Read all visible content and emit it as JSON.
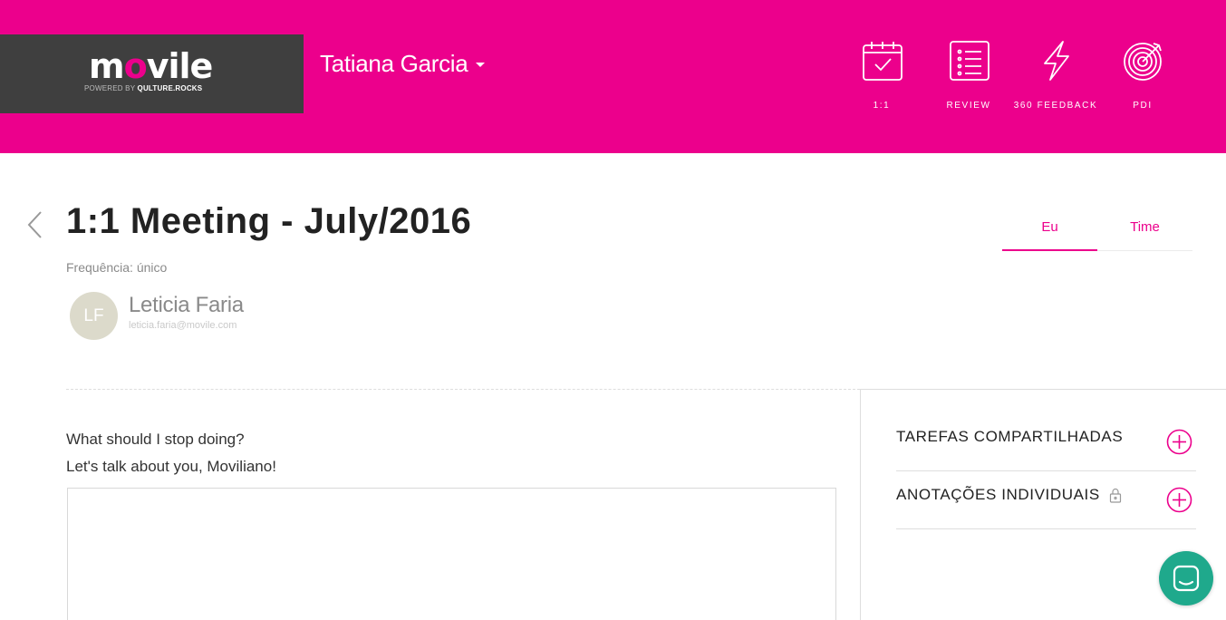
{
  "brand": {
    "logo_prefix": "m",
    "logo_o": "o",
    "logo_suffix": "vile",
    "powered_by": "POWERED BY",
    "powered_brand": "QULTURE.ROCKS",
    "accent_color": "#ec008c",
    "logo_bg": "#3f3f3f"
  },
  "header": {
    "user_name": "Tatiana Garcia",
    "nav": [
      {
        "label": "1:1",
        "icon": "calendar-check-icon"
      },
      {
        "label": "REVIEW",
        "icon": "list-icon"
      },
      {
        "label": "360 FEEDBACK",
        "icon": "lightning-icon"
      },
      {
        "label": "PDI",
        "icon": "target-icon"
      }
    ]
  },
  "meeting": {
    "title": "1:1 Meeting - July/2016",
    "frequency": "Frequência: único",
    "person": {
      "initials": "LF",
      "name": "Leticia Faria",
      "email": "leticia.faria@movile.com"
    }
  },
  "tabs": [
    {
      "label": "Eu",
      "active": true
    },
    {
      "label": "Time",
      "active": false
    }
  ],
  "form": {
    "question": "What should I stop doing?",
    "subtitle": "Let's talk about you, Moviliano!",
    "answer_value": ""
  },
  "sidebar": {
    "sections": [
      {
        "title": "TAREFAS COMPARTILHADAS",
        "locked": false
      },
      {
        "title": "ANOTAÇÕES INDIVIDUAIS",
        "locked": true
      }
    ]
  },
  "chat": {
    "icon": "chat-icon",
    "color": "#1fa98c"
  }
}
